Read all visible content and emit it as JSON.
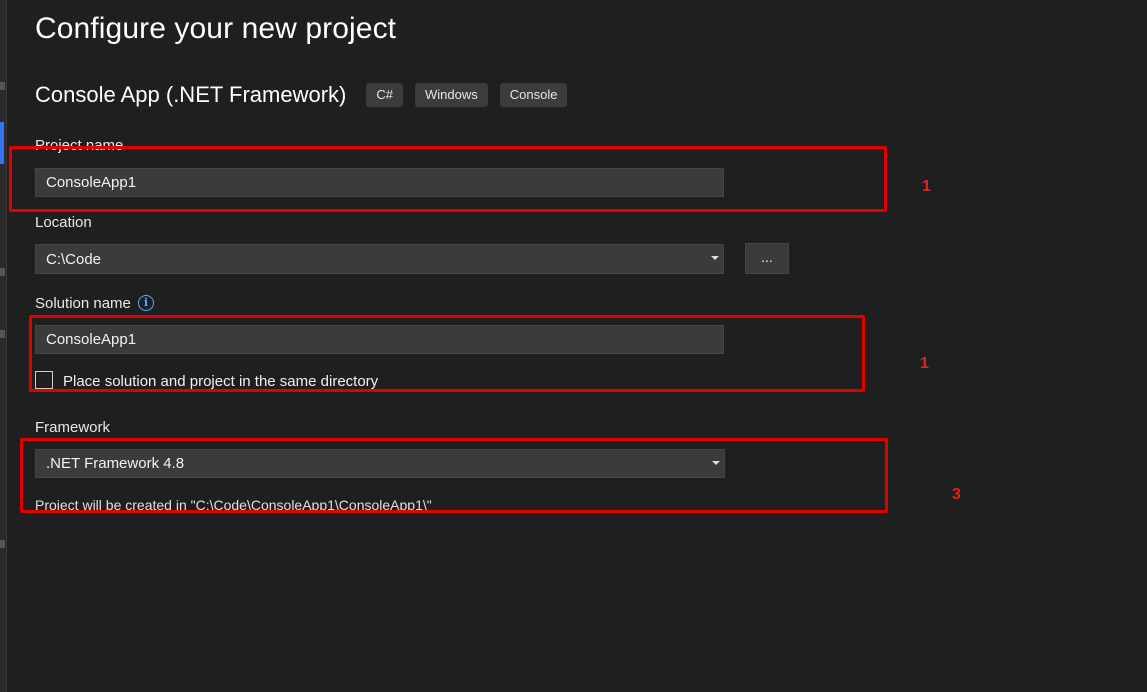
{
  "page": {
    "heading": "Configure your new project",
    "template_name": "Console App (.NET Framework)",
    "tags": [
      "C#",
      "Windows",
      "Console"
    ]
  },
  "project_name": {
    "label": "Project name",
    "value": "ConsoleApp1"
  },
  "location": {
    "label": "Location",
    "value": "C:\\Code",
    "browse_label": "..."
  },
  "solution_name": {
    "label": "Solution name",
    "value": "ConsoleApp1",
    "info_icon": "info-icon",
    "same_dir_label": "Place solution and project in the same directory",
    "same_dir_checked": false
  },
  "framework": {
    "label": "Framework",
    "value": ".NET Framework 4.8",
    "path_note": "Project will be created in \"C:\\Code\\ConsoleApp1\\ConsoleApp1\\\""
  },
  "annotations": {
    "color": "#e00000",
    "labels": [
      "1",
      "1",
      "3"
    ]
  },
  "colors": {
    "background": "#1f1f1f",
    "field": "#3b3b3b",
    "accent": "#3574f0",
    "annotation": "#e00000"
  }
}
